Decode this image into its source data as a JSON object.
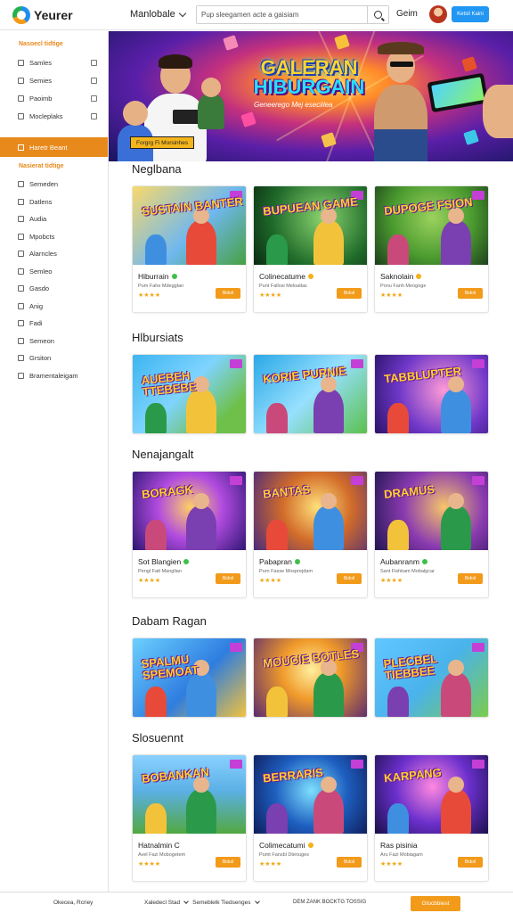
{
  "header": {
    "logo_text": "Yeurer",
    "nav_dropdown": "Manlobale",
    "search_placeholder": "Pup sleegamen acte a gaisiam",
    "login_label": "Geim",
    "signup_label": "Ketsil Kaini",
    "accent": "#2196f3"
  },
  "sidebar": {
    "group1_title": "Nasoecl tidtige",
    "group1_items": [
      {
        "label": "Samles",
        "icon": "compass-icon"
      },
      {
        "label": "Semies",
        "icon": "grid-icon"
      },
      {
        "label": "Paoimb",
        "icon": "gift-icon"
      },
      {
        "label": "Mocleplaks",
        "icon": "controller-icon"
      }
    ],
    "active_item": "Haretr Beant",
    "group2_title": "Nasierat tidtige",
    "group2_items": [
      {
        "label": "Semeden"
      },
      {
        "label": "Datlens"
      },
      {
        "label": "Audia"
      },
      {
        "label": "Mpobcts"
      },
      {
        "label": "Alarncles"
      },
      {
        "label": "Semleo"
      },
      {
        "label": "Gasdo"
      },
      {
        "label": "Anig"
      },
      {
        "label": "Fadi"
      },
      {
        "label": "Semeon"
      },
      {
        "label": "Grsiton"
      },
      {
        "label": "Bramentaleigam"
      }
    ],
    "accent": "#e8891c"
  },
  "hero": {
    "title_line1": "GALERAN",
    "title_line2": "HIBURGAIN",
    "subtitle": "Geneerego Mej eseciilea",
    "button_label": "Forgrg Fi Morsinhes"
  },
  "sections": [
    {
      "title": "Neglbana",
      "cards": [
        {
          "thumb_text": "SUSTAIN BANTER",
          "name": "Hiburrain",
          "badge": "green",
          "sub": "Pum Fahe Mdegglan",
          "stars": "★★★★",
          "button": "Bidoil"
        },
        {
          "thumb_text": "BUPUEAN GAME",
          "name": "Colinecatume",
          "badge": "yellow",
          "sub": "Punt Fallosi Meloatlas",
          "stars": "★★★★",
          "button": "Bidoil"
        },
        {
          "thumb_text": "DUPOGE FSION",
          "name": "Saknolain",
          "badge": "yellow",
          "sub": "Ponu Fanh Meogoge",
          "stars": "★★★★",
          "button": "Bidoil"
        }
      ]
    },
    {
      "title": "Hlbursiats",
      "cards": [
        {
          "thumb_text": "AUEBEH TTEBEBE"
        },
        {
          "thumb_text": "KORIE PURNIE"
        },
        {
          "thumb_text": "TABBLUPTER"
        }
      ]
    },
    {
      "title": "Nenajangalt",
      "cards": [
        {
          "thumb_text": "BORAGK",
          "name": "Sot Blangien",
          "badge": "green",
          "sub": "Pengl Fatt Manglian",
          "stars": "★★★★",
          "button": "Bidoil"
        },
        {
          "thumb_text": "BANTAS",
          "name": "Pabapran",
          "badge": "green",
          "sub": "Purn Fasse Mosprejdam",
          "stars": "★★★★",
          "button": "Bidoil"
        },
        {
          "thumb_text": "DRAMUS",
          "name": "Aubanranm",
          "badge": "green",
          "sub": "Sant Fishkam Mobalgcar",
          "stars": "★★★★",
          "button": "Bidoil"
        }
      ]
    },
    {
      "title": "Dabam Ragan",
      "cards": [
        {
          "thumb_text": "SPALMU SPEMOAT"
        },
        {
          "thumb_text": "MOUCIE BOTLES"
        },
        {
          "thumb_text": "PLECBEL TIEBBEE"
        }
      ]
    },
    {
      "title": "Slosuennt",
      "cards": [
        {
          "thumb_text": "BOBANKAN",
          "name": "Hatnalmin C",
          "badge": "none",
          "sub": "Avel Fazi Mobogetem",
          "stars": "★★★★",
          "button": "Bidoil"
        },
        {
          "thumb_text": "BERRARIS",
          "name": "Colimecatumi",
          "badge": "yellow",
          "sub": "Pumt Fansbl Dtenuges",
          "stars": "★★★★",
          "button": "Bidoil"
        },
        {
          "thumb_text": "KARPANG",
          "name": "Ras pisinia",
          "badge": "none",
          "sub": "Aru Fazi Mobiagam",
          "stars": "★★★★",
          "button": "Bidoil"
        }
      ]
    }
  ],
  "footer": {
    "left": "Okecea, Rcriey",
    "mid_select": "Xaledecl Stad",
    "mid_select2": "Semeblelk Tiedsenges",
    "links": "DEM ZANK BOCKTG TOSSIG",
    "button": "Gtocbbiest"
  }
}
